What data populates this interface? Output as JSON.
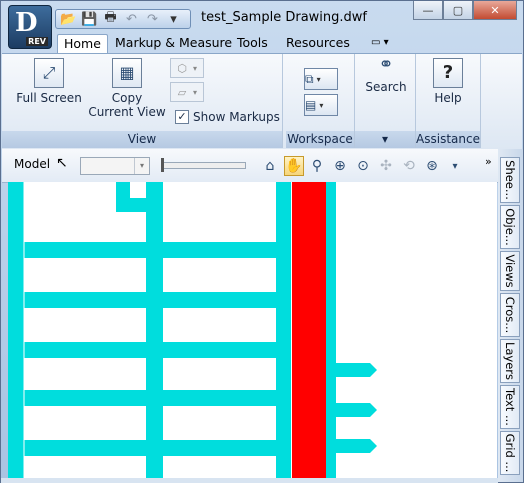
{
  "window": {
    "title": "test_Sample Drawing.dwf"
  },
  "app_button": {
    "letter": "D",
    "badge": "REV"
  },
  "quick_access": {
    "icons": [
      "open-icon",
      "save-icon",
      "print-icon",
      "undo-icon",
      "redo-icon",
      "dropdown-icon"
    ],
    "glyphs": [
      "📂",
      "💾",
      "🖶",
      "↶",
      "↷",
      "▾"
    ]
  },
  "window_controls": {
    "minimize": "—",
    "maximize": "▢",
    "close": "✕"
  },
  "tabs": [
    {
      "label": "Home",
      "active": true
    },
    {
      "label": "Markup & Measure"
    },
    {
      "label": "Tools"
    },
    {
      "label": "Resources"
    },
    {
      "label": "▭ ▾"
    }
  ],
  "ribbon": {
    "view_panel": {
      "label": "View",
      "full_screen": "Full Screen",
      "copy_current_view": "Copy Current View",
      "show_markups": "Show Markups",
      "show_markups_checked": true
    },
    "workspace_panel": {
      "label": "Workspace"
    },
    "search_panel": {
      "label": "Search",
      "footer": "▾"
    },
    "assistance_panel": {
      "label": "Assistance",
      "help": "Help"
    }
  },
  "toolbar": {
    "model_label": "Model",
    "combo_value": "",
    "more": "»"
  },
  "sidebar_tabs": [
    "Shee...",
    "Obje...",
    "Views",
    "Cros...",
    "Layers",
    "Text ...",
    "Grid ..."
  ],
  "colors": {
    "road": "#00dddd",
    "highlight": "#ff0000",
    "accent": "#c79a2b"
  }
}
